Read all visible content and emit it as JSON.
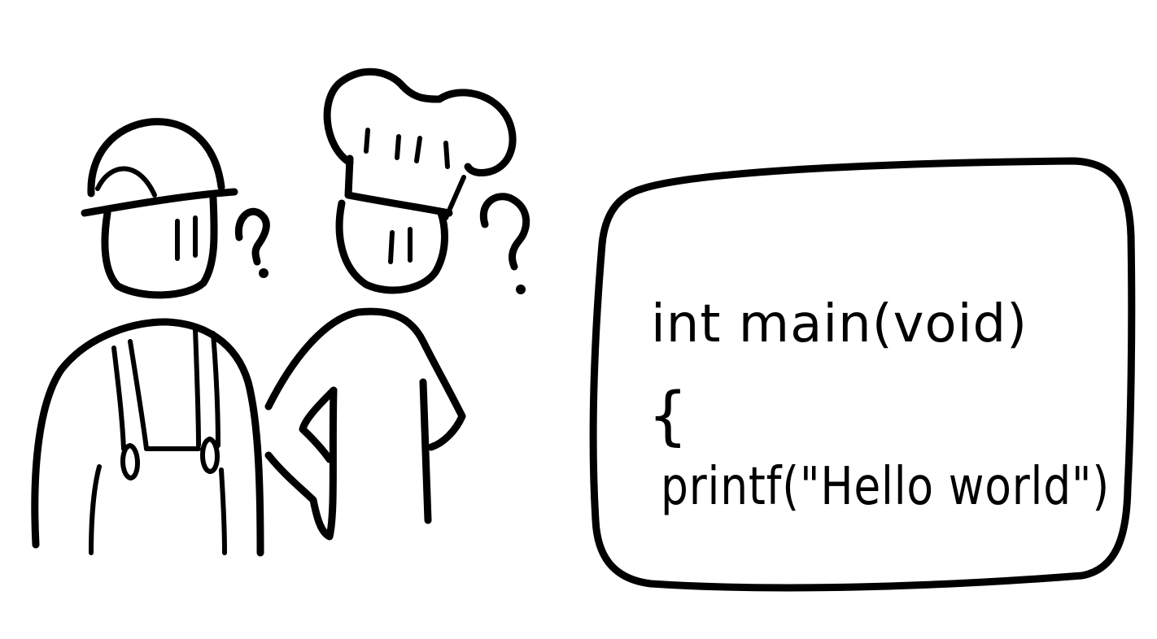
{
  "colors": {
    "ink": "#000000",
    "paper": "#ffffff"
  },
  "people": [
    {
      "role": "construction-worker",
      "thought": "?"
    },
    {
      "role": "chef",
      "thought": "?"
    }
  ],
  "code_box": {
    "lines": [
      "int main(void)",
      "{",
      "printf(\"Hello world\")"
    ]
  }
}
